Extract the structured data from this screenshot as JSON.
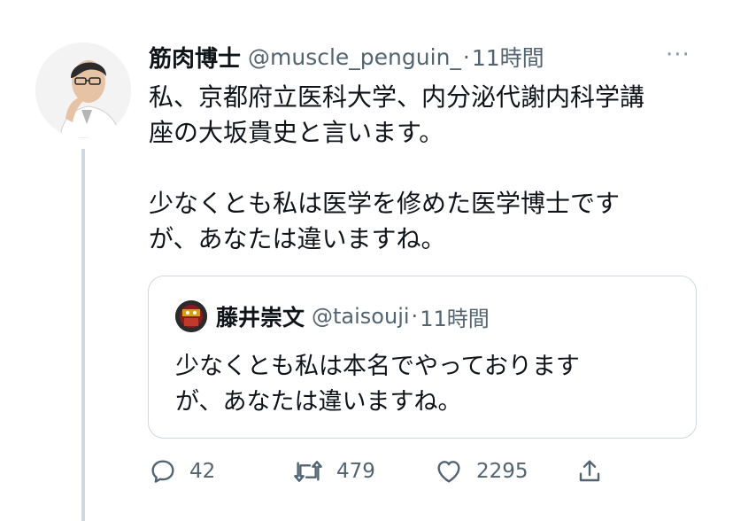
{
  "tweet": {
    "display_name": "筋肉博士",
    "handle": "@muscle_penguin_",
    "dot": "·",
    "time": "11時間",
    "more": "···",
    "text": "私、京都府立医科大学、内分泌代謝内科学講\n座の大坂貴史と言います。\n\n少なくとも私は医学を修めた医学博士です\nが、あなたは違いますね。"
  },
  "quote": {
    "display_name": "藤井崇文",
    "handle": "@taisouji",
    "dot": "·",
    "time": "11時間",
    "text": "少なくとも私は本名でやっております\nが、あなたは違いますね。"
  },
  "actions": {
    "reply_count": "42",
    "retweet_count": "479",
    "like_count": "2295"
  },
  "icons": {
    "reply": "reply-icon",
    "retweet": "retweet-icon",
    "like": "heart-icon",
    "share": "share-icon",
    "more": "more-icon"
  },
  "colors": {
    "text": "#0f1419",
    "secondary": "#536471",
    "border": "#cfd9de"
  }
}
